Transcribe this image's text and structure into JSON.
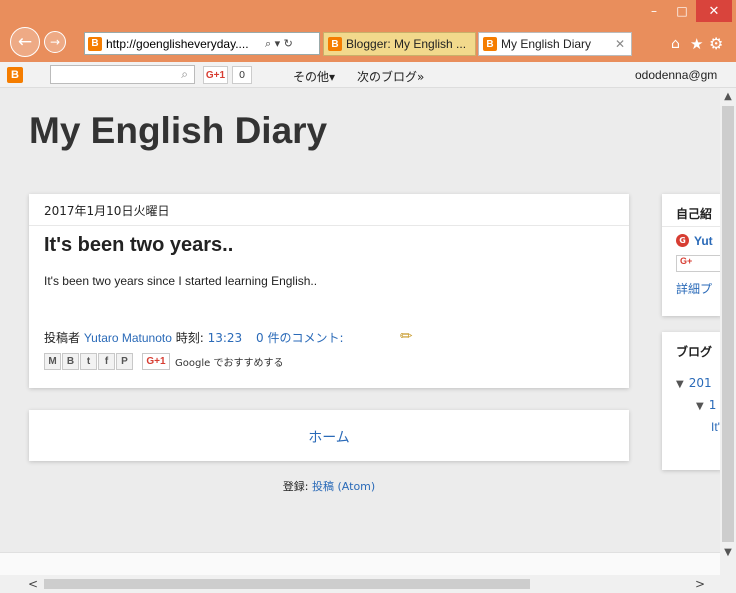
{
  "window": {
    "minimize_glyph": "–",
    "maximize_glyph": "□",
    "close_glyph": "✕"
  },
  "browser": {
    "back_glyph": "←",
    "forward_glyph": "→",
    "address": "http://goenglisheveryday....",
    "address_icons": "⌕ ▾ ↻",
    "tabs": [
      {
        "label": "Blogger: My English ..."
      },
      {
        "label": "My English Diary",
        "close": "✕"
      }
    ],
    "toolbar_icons": {
      "home": "⌂",
      "favorites": "★",
      "settings": "⚙"
    }
  },
  "navbar": {
    "logo": "B",
    "search_placeholder": "",
    "gplus_label": "G+1",
    "gplus_count": "0",
    "more": "その他▾",
    "next_blog": "次のブログ»",
    "user": "ododenna@gm"
  },
  "blog": {
    "title": "My English Diary",
    "post": {
      "date": "2017年1月10日火曜日",
      "title": "It's been two years..",
      "body": "It's been two years since I started learning English..",
      "posted_by": "投稿者",
      "author": "Yutaro Matunoto",
      "time_label": "時刻:",
      "time": "13:23",
      "comments": "0 件のコメント:",
      "share_buttons": [
        "M",
        "B",
        "t",
        "f",
        "P"
      ],
      "gplus_label": "G+1",
      "gplus_text": "Google でおすすめする"
    },
    "home_link": "ホーム",
    "subscribe_label": "登録:",
    "subscribe_link": "投稿 (Atom)"
  },
  "sidebar": {
    "profile": {
      "title": "自己紹",
      "name": "Yut",
      "follow": "G+",
      "more": "詳細プ"
    },
    "archive": {
      "title": "ブログ",
      "year": "201",
      "month": "1",
      "post": "It'"
    }
  },
  "scrollbars": {
    "up": "▲",
    "down": "▼",
    "left": "<",
    "right": ">"
  }
}
